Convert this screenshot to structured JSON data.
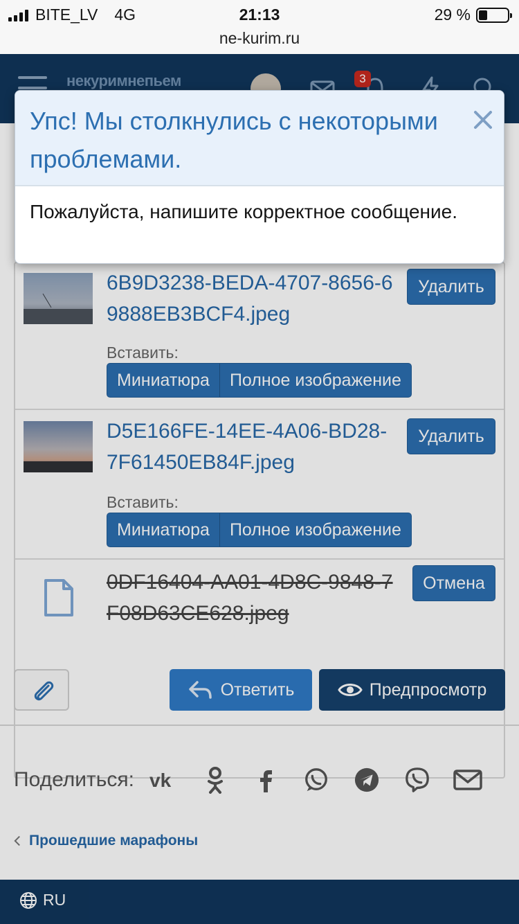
{
  "status_bar": {
    "carrier": "BITE_LV",
    "network": "4G",
    "time": "21:13",
    "battery_percent": "29 %",
    "battery_level": 0.29,
    "url": "ne-kurim.ru"
  },
  "header": {
    "logo": "некуримнепьем",
    "notification_count": "3",
    "icons": [
      "menu-icon",
      "avatar",
      "mail-icon",
      "bell-icon",
      "lightning-icon",
      "search-icon"
    ]
  },
  "attachments": [
    {
      "filename": "6B9D3238-BEDA-4707-8656-69888EB3BCF4.jpeg",
      "action": "Удалить",
      "insert_label": "Вставить:",
      "thumb_label": "Миниатюра",
      "full_label": "Полное изображение"
    },
    {
      "filename": "D5E166FE-14EE-4A06-BD28-7F61450EB84F.jpeg",
      "action": "Удалить",
      "insert_label": "Вставить:",
      "thumb_label": "Миниатюра",
      "full_label": "Полное изображение"
    },
    {
      "filename": "0DF16404-AA01-4D8C-9848-7F08D63CE628.jpeg",
      "action": "Отмена"
    }
  ],
  "actions": {
    "reply": "Ответить",
    "preview": "Предпросмотр"
  },
  "share": {
    "label": "Поделиться:",
    "icons": [
      "vk-icon",
      "odnoklassniki-icon",
      "facebook-icon",
      "whatsapp-icon",
      "telegram-icon",
      "viber-icon",
      "email-icon"
    ]
  },
  "breadcrumb": "Прошедшие марафоны",
  "footer": {
    "language": "RU"
  },
  "modal": {
    "title": "Упс! Мы столкнулись с некоторыми проблемами.",
    "message": "Пожалуйста, напишите корректное сообщение."
  },
  "colors": {
    "header_bg": "#10365c",
    "link": "#2768a8",
    "button": "#2c6fb1",
    "modal_title": "#2c6fb1",
    "badge": "#c8291f"
  }
}
